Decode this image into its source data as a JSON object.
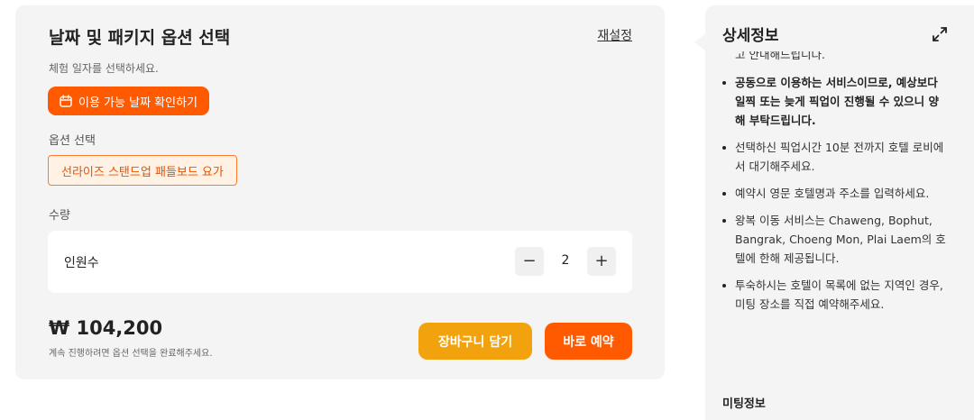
{
  "booking": {
    "title": "날짜 및 패키지 옵션 선택",
    "reset_label": "재설정",
    "date_hint": "체험 일자를 선택하세요.",
    "date_button_label": "이용 가능 날짜 확인하기",
    "date_button_icon": "calendar-icon",
    "option_label": "옵션 선택",
    "option_selected": "선라이즈 스탠드업 패들보드 요가",
    "quantity_label": "수량",
    "quantity_item_name": "인원수",
    "quantity_value": "2",
    "minus_label": "−",
    "plus_label": "+",
    "price": "₩ 104,200",
    "price_note": "계속 진행하려면 옵션 선택을 완료해주세요.",
    "cart_button_label": "장바구니 담기",
    "book_button_label": "바로 예약"
  },
  "details": {
    "title": "상세정보",
    "expand_icon": "expand-icon",
    "clipped_text": "고 안내해드립니다.",
    "notes": [
      "공동으로 이용하는 서비스이므로, 예상보다 일찍 또는 늦게 픽업이 진행될 수 있으니 양해 부탁드립니다.",
      "선택하신 픽업시간 10분 전까지 호텔 로비에서 대기해주세요.",
      "예약시 영문 호텔명과 주소를 입력하세요.",
      "왕복 이동 서비스는 Chaweng, Bophut, Bangrak, Choeng Mon, Plai Laem의 호텔에 한해 제공됩니다.",
      "투숙하시는 호텔이 목록에 없는 지역인 경우, 미팅 장소를 직접 예약해주세요."
    ],
    "meeting_title": "미팅정보"
  },
  "colors": {
    "primary": "#ff5a00",
    "cart": "#f2a20c",
    "panel_bg": "#f4f4f4",
    "chip_bg": "#fff1e4"
  }
}
